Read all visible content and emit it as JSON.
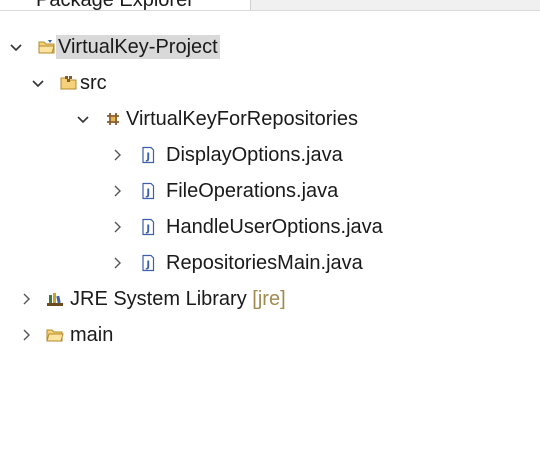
{
  "view": {
    "tab_title": "Package Explorer"
  },
  "tree": {
    "project": {
      "label": "VirtualKey-Project",
      "icon": "java-project-icon",
      "expanded": true
    },
    "src": {
      "label": "src",
      "icon": "source-folder-icon",
      "expanded": true
    },
    "package": {
      "label": "VirtualKeyForRepositories",
      "icon": "package-icon",
      "expanded": true
    },
    "files": [
      {
        "label": "DisplayOptions.java",
        "icon": "java-file-icon"
      },
      {
        "label": "FileOperations.java",
        "icon": "java-file-icon"
      },
      {
        "label": "HandleUserOptions.java",
        "icon": "java-file-icon"
      },
      {
        "label": "RepositoriesMain.java",
        "icon": "java-file-icon"
      }
    ],
    "jre": {
      "label": "JRE System Library",
      "decoration": "[jre]",
      "icon": "library-icon",
      "expanded": false
    },
    "main": {
      "label": "main",
      "icon": "folder-icon",
      "expanded": false
    }
  },
  "colors": {
    "selection": "#d9d9d9",
    "decoration": "#a08a4f",
    "folder": "#e6b84a",
    "java_file": "#3b5fa8"
  }
}
